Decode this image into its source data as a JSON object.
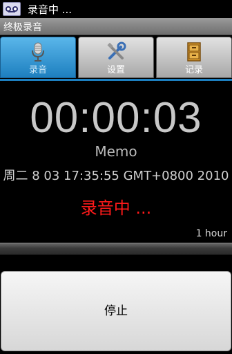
{
  "status_bar": {
    "text": "录音中 ..."
  },
  "title_bar": {
    "title": "终极录音"
  },
  "tabs": [
    {
      "label": "录音",
      "icon": "microphone-icon",
      "selected": true
    },
    {
      "label": "设置",
      "icon": "tools-icon",
      "selected": false
    },
    {
      "label": "记录",
      "icon": "file-cabinet-icon",
      "selected": false
    }
  ],
  "recorder": {
    "elapsed": "00:00:03",
    "name": "Memo",
    "datetime": "周二 8 03 17:35:55 GMT+0800 2010",
    "status": "录音中 ...",
    "max_duration": "1 hour",
    "progress": 0.0
  },
  "stop_button": {
    "label": "停止"
  },
  "colors": {
    "tab_active": "#1d7fbf",
    "recording_text": "#ff1a1a",
    "timer_text": "#c8c8c8"
  }
}
